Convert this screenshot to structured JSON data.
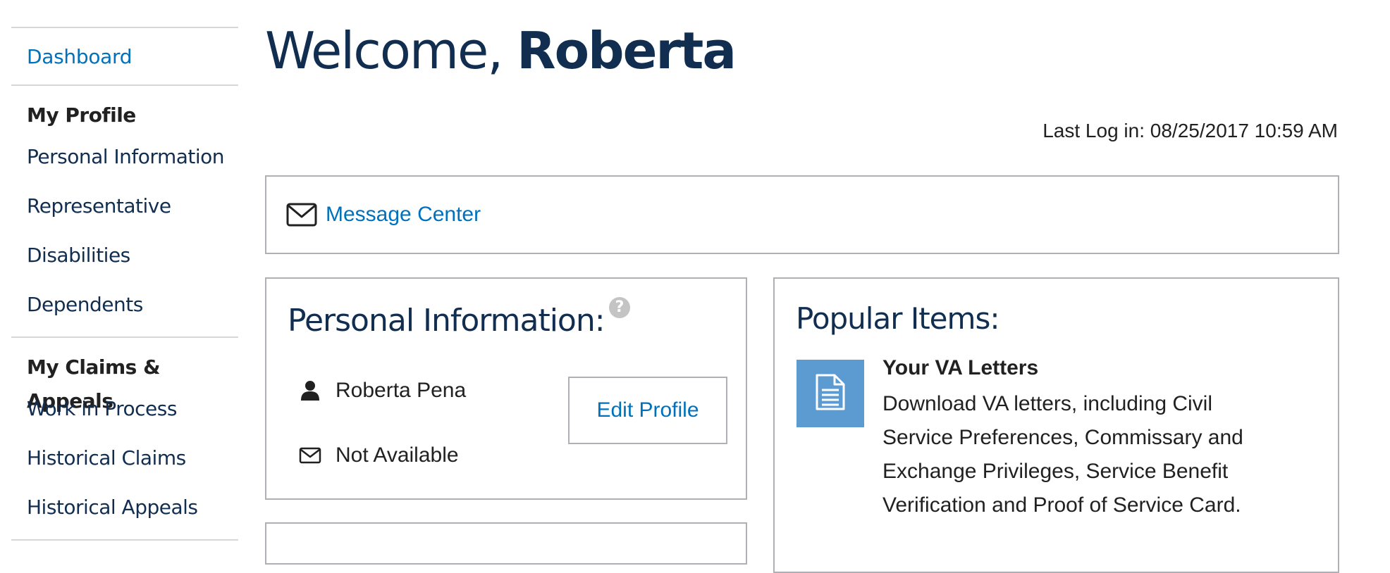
{
  "sidebar": {
    "dashboard_label": "Dashboard",
    "sections": [
      {
        "heading": "My Profile",
        "items": [
          {
            "label": "Personal Information"
          },
          {
            "label": "Representative"
          },
          {
            "label": "Disabilities"
          },
          {
            "label": "Dependents"
          }
        ]
      },
      {
        "heading": "My Claims & Appeals",
        "items": [
          {
            "label": "Work in Process"
          },
          {
            "label": "Historical Claims"
          },
          {
            "label": "Historical Appeals"
          }
        ]
      }
    ]
  },
  "header": {
    "welcome_prefix": "Welcome,",
    "user_first_name": "Roberta"
  },
  "last_login": "Last Log in: 08/25/2017 10:59 AM",
  "message_center": {
    "label": "Message Center",
    "icon": "envelope-icon"
  },
  "personal_info": {
    "title": "Personal Information:",
    "help_icon": "question-circle-icon",
    "name": "Roberta Pena",
    "name_icon": "user-icon",
    "email": "Not Available",
    "email_icon": "envelope-icon",
    "edit_button": "Edit Profile"
  },
  "popular_items": {
    "title": "Popular Items:",
    "items": [
      {
        "icon": "document-icon",
        "title": "Your VA Letters",
        "description": "Download VA letters, including Civil Service Preferences, Commissary and Exchange Privileges, Service Benefit Verification and Proof of Service Card."
      }
    ]
  },
  "colors": {
    "link": "#0071bb",
    "heading": "#112e51",
    "border": "#aeb0b5",
    "icon_tile": "#5b9bd1"
  }
}
